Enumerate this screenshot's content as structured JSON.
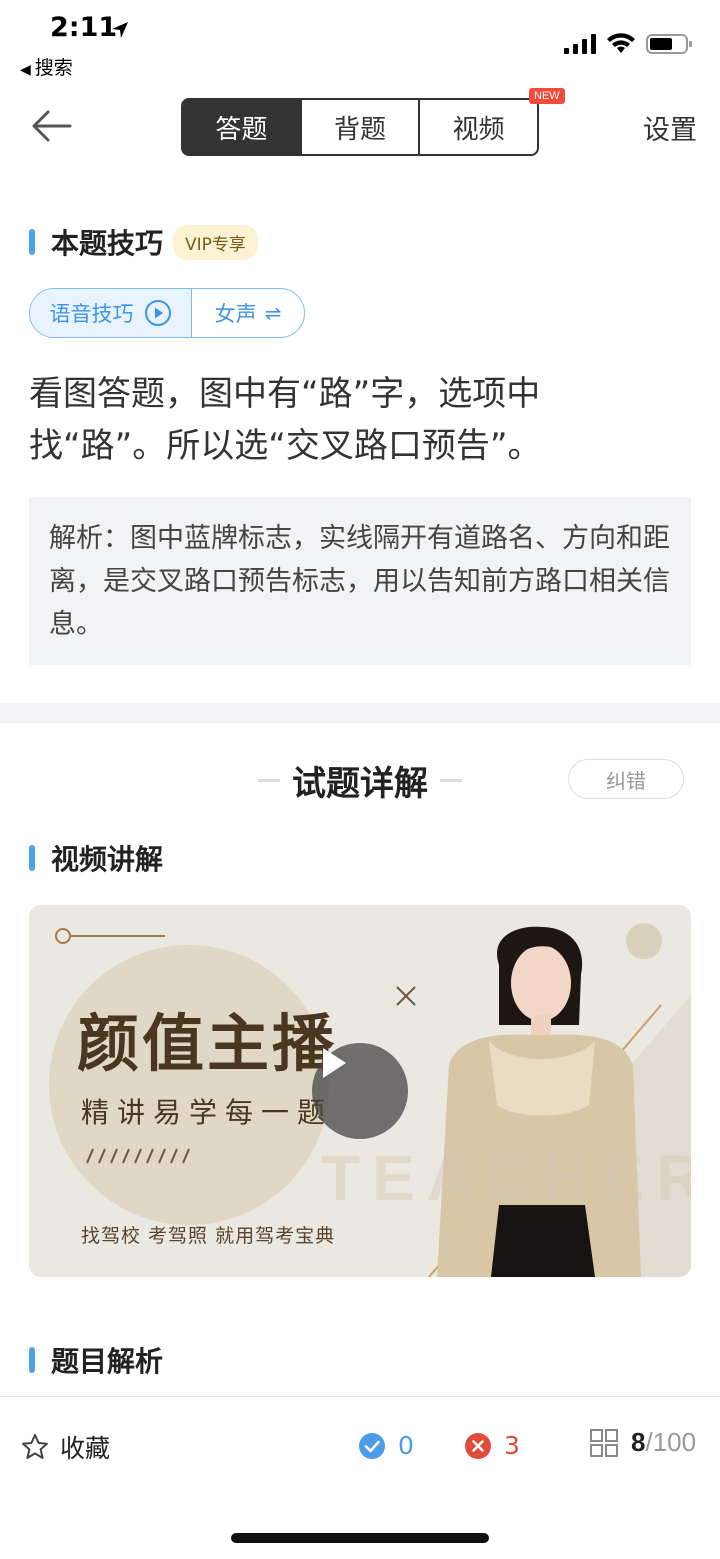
{
  "status_bar": {
    "time": "2:11",
    "back_app": "搜索"
  },
  "nav": {
    "tabs": [
      {
        "label": "答题",
        "active": true
      },
      {
        "label": "背题",
        "active": false
      },
      {
        "label": "视频",
        "active": false
      }
    ],
    "new_badge": "NEW",
    "settings_label": "设置"
  },
  "tips": {
    "title": "本题技巧",
    "vip_badge": "VIP专享",
    "voice_label": "语音技巧",
    "voice_gender": "女声",
    "text": "看图答题，图中有“路”字，选项中找“路”。所以选“交叉路口预告”。",
    "analysis": "解析：图中蓝牌标志，实线隔开有道路名、方向和距离，是交叉路口预告标志，用以告知前方路口相关信息。"
  },
  "detail": {
    "title": "试题详解",
    "correct_button": "纠错"
  },
  "video_section": {
    "title": "视频讲解",
    "card": {
      "headline": "颜值主播",
      "subline": "精讲易学每一题",
      "slogan": "找驾校 考驾照 就用驾考宝典",
      "watermark": "TEACHER"
    }
  },
  "question_analysis": {
    "title": "题目解析"
  },
  "bottom_bar": {
    "favorite_label": "收藏",
    "correct_count": "0",
    "wrong_count": "3",
    "current": "8",
    "total": "/100"
  },
  "colors": {
    "accent_blue": "#4aa3f0",
    "wrong_red": "#e24b3c",
    "dark_segment": "#333333",
    "vip_bg": "#fdf3d2"
  }
}
